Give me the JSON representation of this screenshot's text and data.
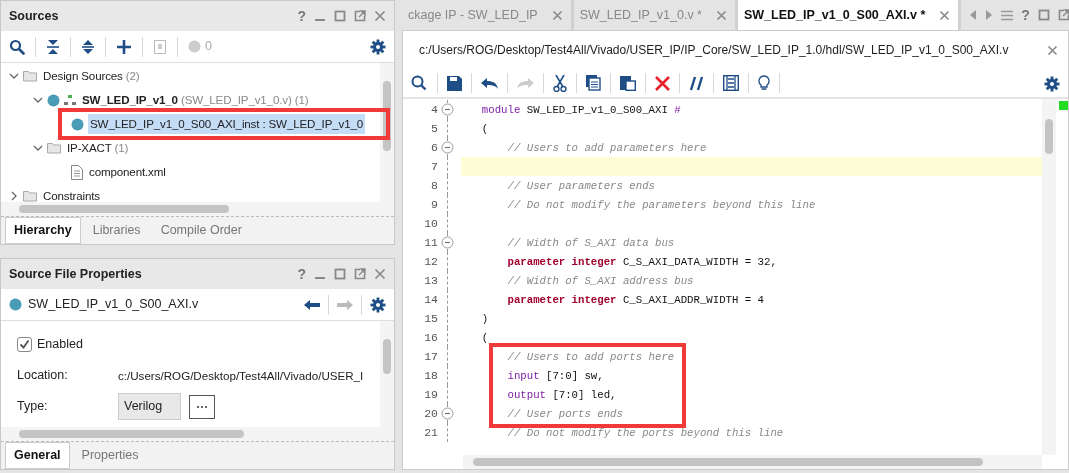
{
  "sources_panel": {
    "title": "Sources",
    "help": "?",
    "toolbar": {
      "count": "0"
    },
    "tree": [
      {
        "kind": "folder",
        "label": "Design Sources",
        "detail": "(2)",
        "expanded": true,
        "selected": false,
        "boxed": false,
        "children": [
          {
            "kind": "module",
            "label": "SW_LED_IP_v1_0",
            "detail": "(SW_LED_IP_v1_0.v) (1)",
            "expanded": true,
            "selected": false,
            "boxed": false,
            "children": [
              {
                "kind": "instance",
                "label": "SW_LED_IP_v1_0_S00_AXI_inst : SW_LED_IP_v1_0",
                "selected": true,
                "boxed": true
              }
            ]
          },
          {
            "kind": "folder",
            "label": "IP-XACT",
            "detail": "(1)",
            "expanded": true,
            "selected": false,
            "boxed": false,
            "children": [
              {
                "kind": "file",
                "label": "component.xml",
                "selected": false,
                "boxed": false
              }
            ]
          }
        ]
      },
      {
        "kind": "folder",
        "label": "Constraints",
        "expanded": false,
        "selected": false,
        "boxed": false
      }
    ],
    "tabs": [
      {
        "label": "Hierarchy",
        "selected": true
      },
      {
        "label": "Libraries",
        "selected": false
      },
      {
        "label": "Compile Order",
        "selected": false
      }
    ]
  },
  "properties_panel": {
    "title": "Source File Properties",
    "help": "?",
    "file": "SW_LED_IP_v1_0_S00_AXI.v",
    "enabled": {
      "label": "Enabled",
      "checked": true
    },
    "fields": [
      {
        "kind": "text",
        "label": "Location:",
        "value": "c:/Users/ROG/Desktop/Test4All/Vivado/USER_I"
      },
      {
        "kind": "select",
        "label": "Type:",
        "value": "Verilog",
        "button": "⋯"
      }
    ],
    "tabs": [
      {
        "label": "General",
        "selected": true
      },
      {
        "label": "Properties",
        "selected": false
      }
    ]
  },
  "editor": {
    "tabs": [
      {
        "label": "ckage IP - SW_LED_IP",
        "selected": false
      },
      {
        "label": "SW_LED_IP_v1_0.v *",
        "selected": false
      },
      {
        "label": "SW_LED_IP_v1_0_S00_AXI.v *",
        "selected": true
      }
    ],
    "help": "?",
    "path": "c:/Users/ROG/Desktop/Test4All/Vivado/USER_IP/IP_Core/SW_LED_IP_1.0/hdl/SW_LED_IP_v1_0_S00_AXI.v",
    "lines": [
      {
        "number": "4",
        "fold": true,
        "current": false,
        "boxed": false,
        "segments": [
          {
            "kind": "keyword",
            "text": "  module"
          },
          {
            "kind": "text",
            "text": " SW_LED_IP_v1_0_S00_AXI "
          },
          {
            "kind": "keyword",
            "text": "#"
          }
        ]
      },
      {
        "number": "5",
        "fold": false,
        "current": false,
        "boxed": false,
        "segments": [
          {
            "kind": "text",
            "text": "  ("
          }
        ]
      },
      {
        "number": "6",
        "fold": true,
        "current": false,
        "boxed": false,
        "segments": [
          {
            "kind": "comment",
            "text": "      // Users to add parameters here"
          }
        ]
      },
      {
        "number": "7",
        "fold": false,
        "current": true,
        "boxed": false
      },
      {
        "number": "8",
        "fold": false,
        "current": false,
        "boxed": false,
        "segments": [
          {
            "kind": "comment",
            "text": "      // User parameters ends"
          }
        ]
      },
      {
        "number": "9",
        "fold": false,
        "current": false,
        "boxed": false,
        "segments": [
          {
            "kind": "comment",
            "text": "      // Do not modify the parameters beyond this line"
          }
        ]
      },
      {
        "number": "10",
        "fold": false,
        "current": false,
        "boxed": false
      },
      {
        "number": "11",
        "fold": true,
        "current": false,
        "boxed": false,
        "segments": [
          {
            "kind": "comment",
            "text": "      // Width of S_AXI data bus"
          }
        ]
      },
      {
        "number": "12",
        "fold": false,
        "current": false,
        "boxed": false,
        "segments": [
          {
            "kind": "type",
            "text": "      parameter integer"
          },
          {
            "kind": "text",
            "text": " C_S_AXI_DATA_WIDTH = 32,"
          }
        ]
      },
      {
        "number": "13",
        "fold": false,
        "current": false,
        "boxed": false,
        "segments": [
          {
            "kind": "comment",
            "text": "      // Width of S_AXI address bus"
          }
        ]
      },
      {
        "number": "14",
        "fold": false,
        "current": false,
        "boxed": false,
        "segments": [
          {
            "kind": "type",
            "text": "      parameter integer"
          },
          {
            "kind": "text",
            "text": " C_S_AXI_ADDR_WIDTH = 4"
          }
        ]
      },
      {
        "number": "15",
        "fold": false,
        "current": false,
        "boxed": false,
        "segments": [
          {
            "kind": "text",
            "text": "  )"
          }
        ]
      },
      {
        "number": "16",
        "fold": false,
        "current": false,
        "boxed": false,
        "segments": [
          {
            "kind": "text",
            "text": "  ("
          }
        ]
      },
      {
        "number": "17",
        "fold": false,
        "current": false,
        "boxed": true,
        "segments": [
          {
            "kind": "comment",
            "text": "      // Users to add ports here"
          }
        ]
      },
      {
        "number": "18",
        "fold": false,
        "current": false,
        "boxed": true,
        "segments": [
          {
            "kind": "keyword",
            "text": "      input"
          },
          {
            "kind": "text",
            "text": " [7:0] sw,"
          }
        ]
      },
      {
        "number": "19",
        "fold": false,
        "current": false,
        "boxed": true,
        "segments": [
          {
            "kind": "keyword",
            "text": "      output"
          },
          {
            "kind": "text",
            "text": " [7:0] led,"
          }
        ]
      },
      {
        "number": "20",
        "fold": true,
        "current": false,
        "boxed": true,
        "segments": [
          {
            "kind": "comment",
            "text": "      // User ports ends"
          }
        ]
      },
      {
        "number": "21",
        "fold": false,
        "current": false,
        "boxed": false,
        "segments": [
          {
            "kind": "comment",
            "text": "      // Do not modify the ports beyond this line"
          }
        ]
      }
    ]
  }
}
